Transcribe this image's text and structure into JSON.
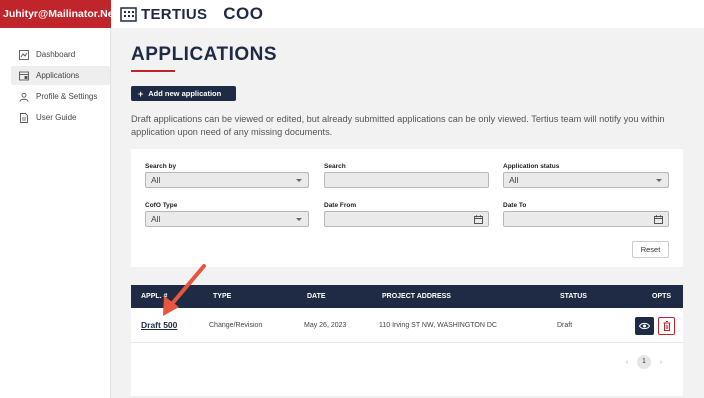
{
  "user": {
    "email": "Juhityr@Mailinator.Net"
  },
  "brand": {
    "name": "TERTIUS",
    "product": "COO",
    "logo_icon": "building-icon"
  },
  "sidebar": {
    "items": [
      {
        "label": "Dashboard",
        "icon": "dashboard-icon",
        "active": false
      },
      {
        "label": "Applications",
        "icon": "applications-icon",
        "active": true
      },
      {
        "label": "Profile & Settings",
        "icon": "profile-icon",
        "active": false
      },
      {
        "label": "User Guide",
        "icon": "guide-icon",
        "active": false
      }
    ]
  },
  "page": {
    "title": "APPLICATIONS",
    "add_button": "Add new application",
    "info": "Draft applications can be viewed or edited, but already submitted applications can be only viewed. Tertius team will notify you within application upon need of any missing documents."
  },
  "filters": {
    "search_by": {
      "label": "Search by",
      "value": "All"
    },
    "search": {
      "label": "Search",
      "value": ""
    },
    "status": {
      "label": "Application status",
      "value": "All"
    },
    "cofo_type": {
      "label": "CofO Type",
      "value": "All"
    },
    "date_from": {
      "label": "Date From",
      "value": ""
    },
    "date_to": {
      "label": "Date To",
      "value": ""
    },
    "reset_label": "Reset"
  },
  "table": {
    "headers": {
      "appl": "APPL. #",
      "type": "TYPE",
      "date": "DATE",
      "address": "PROJECT ADDRESS",
      "status": "STATUS",
      "opts": "OPTS"
    },
    "rows": [
      {
        "appl": "Draft 500",
        "type": "Change/Revision",
        "date": "May 26, 2023",
        "address": "110 Irving ST NW, WASHINGTON DC",
        "status": "Draft"
      }
    ]
  },
  "pagination": {
    "prev": "‹",
    "current": "1",
    "next": "›"
  },
  "colors": {
    "navy": "#1f2a44",
    "red": "#c0252b",
    "annotation": "#e8553e"
  }
}
